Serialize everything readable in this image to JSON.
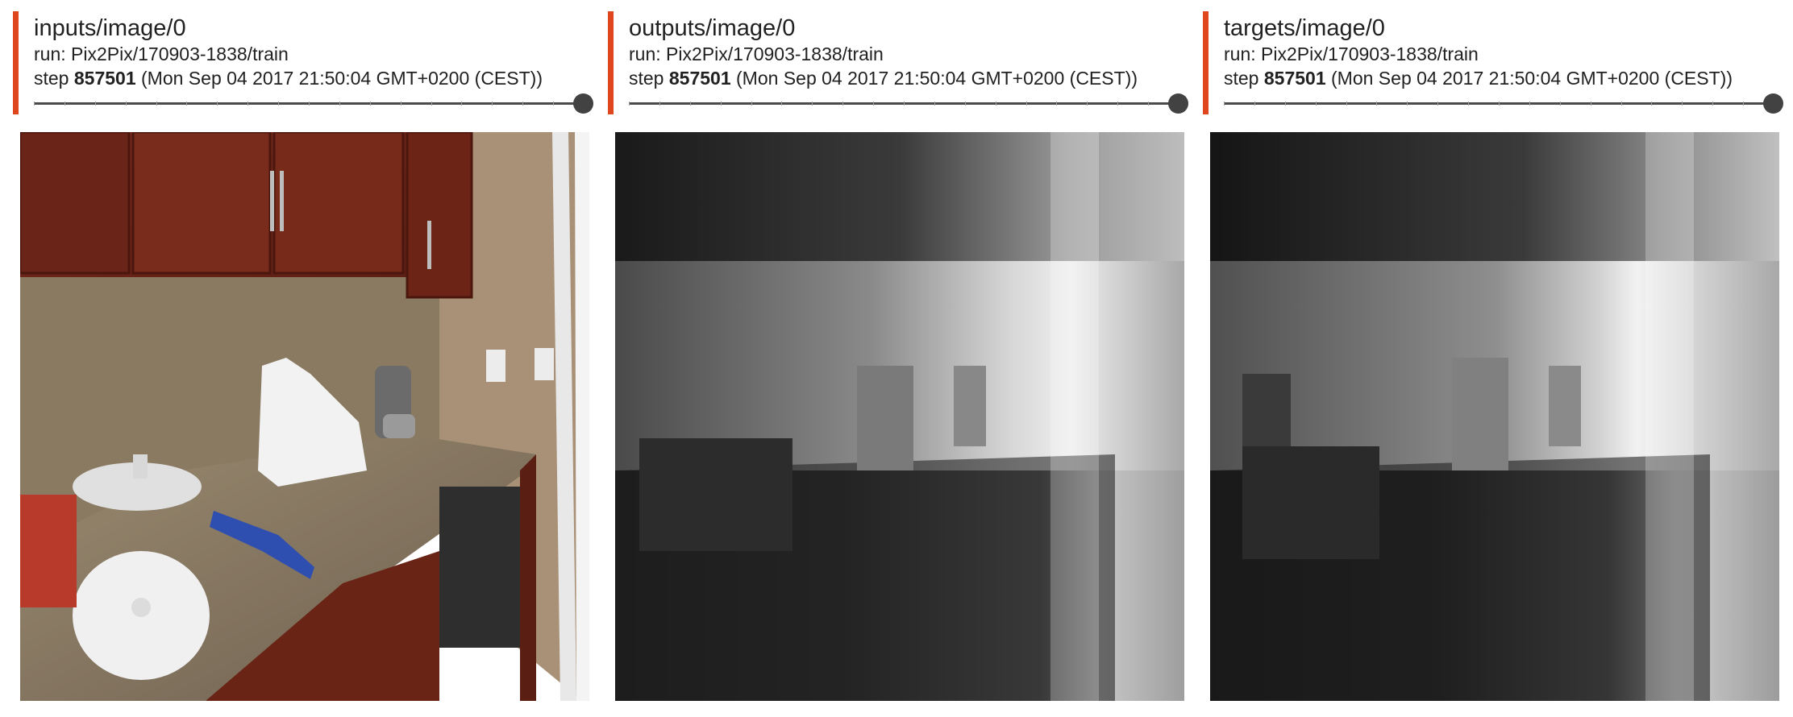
{
  "cards": [
    {
      "tag": "inputs/image/0",
      "run": "run: Pix2Pix/170903-1838/train",
      "step_prefix": "step",
      "step_value": "857501",
      "step_time": "(Mon Sep 04 2017 21:50:04 GMT+0200 (CEST))",
      "image_kind": "rgb-kitchen"
    },
    {
      "tag": "outputs/image/0",
      "run": "run: Pix2Pix/170903-1838/train",
      "step_prefix": "step",
      "step_value": "857501",
      "step_time": "(Mon Sep 04 2017 21:50:04 GMT+0200 (CEST))",
      "image_kind": "depth-output"
    },
    {
      "tag": "targets/image/0",
      "run": "run: Pix2Pix/170903-1838/train",
      "step_prefix": "step",
      "step_value": "857501",
      "step_time": "(Mon Sep 04 2017 21:50:04 GMT+0200 (CEST))",
      "image_kind": "depth-target"
    }
  ],
  "colors": {
    "accent": "#e0461e",
    "slider_track": "#4a4a4a",
    "slider_knob": "#424242"
  }
}
